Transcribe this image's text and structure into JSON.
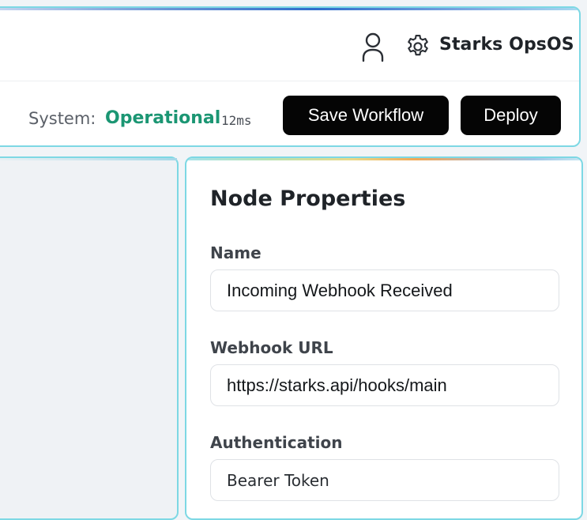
{
  "header": {
    "brand": "Starks OpsOS",
    "status_label": "System:",
    "status_value": "Operational",
    "latency": "12ms",
    "save_label": "Save Workflow",
    "deploy_label": "Deploy",
    "icons": [
      "user-icon",
      "gear-icon"
    ]
  },
  "properties": {
    "title": "Node Properties",
    "fields": [
      {
        "label": "Name",
        "value": "Incoming Webhook Received"
      },
      {
        "label": "Webhook URL",
        "value": "https://starks.api/hooks/main"
      },
      {
        "label": "Authentication",
        "value": "Bearer Token"
      }
    ]
  },
  "colors": {
    "accent_border": "#7dd8e4",
    "status_ok": "#1b9673",
    "button_bg": "#050505"
  }
}
